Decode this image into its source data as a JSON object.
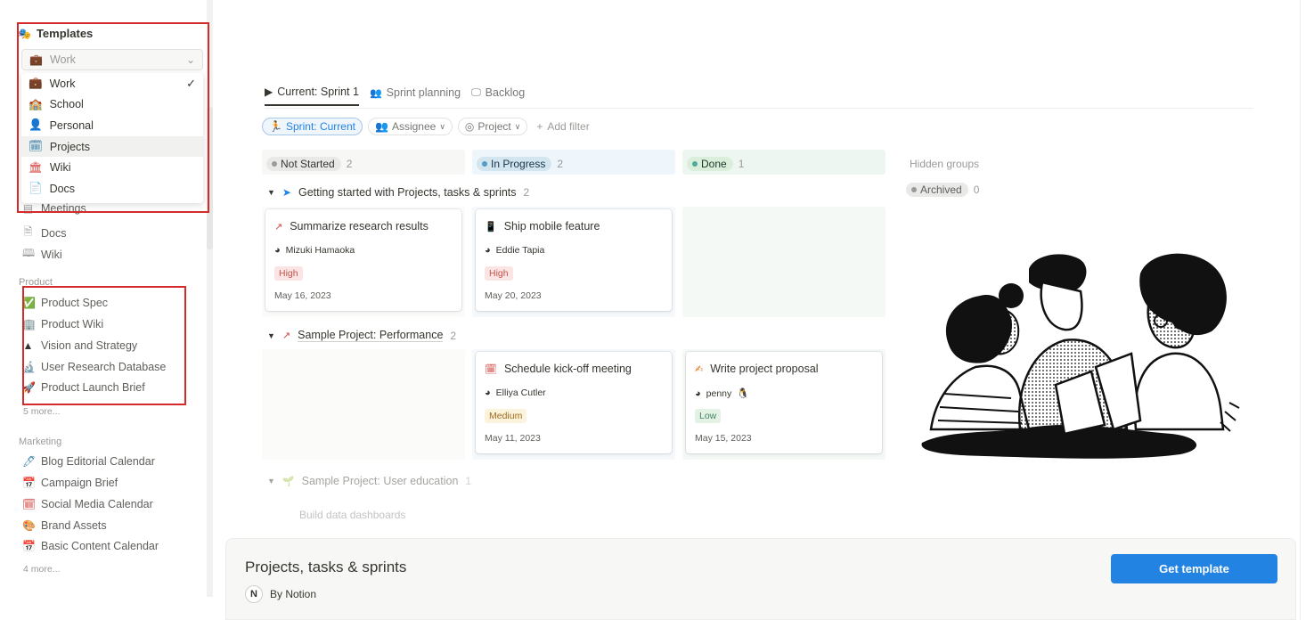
{
  "sidebar": {
    "title": "Templates",
    "select_value": "Work",
    "dropdown": [
      {
        "label": "Work",
        "icon": "briefcase-icon",
        "checked": true
      },
      {
        "label": "School",
        "icon": "school-icon"
      },
      {
        "label": "Personal",
        "icon": "person-icon"
      },
      {
        "label": "Projects",
        "icon": "calendar-icon"
      },
      {
        "label": "Wiki",
        "icon": "library-icon"
      },
      {
        "label": "Docs",
        "icon": "docs-icon"
      }
    ],
    "partial_item": "Meetings",
    "items_top": [
      "Docs",
      "Wiki"
    ],
    "section_product": "Product",
    "product_items": [
      "Product Spec",
      "Product Wiki",
      "Vision and Strategy",
      "User Research Database",
      "Product Launch Brief"
    ],
    "product_more": "5 more...",
    "section_marketing": "Marketing",
    "marketing_items": [
      "Blog Editorial Calendar",
      "Campaign Brief",
      "Social Media Calendar",
      "Brand Assets",
      "Basic Content Calendar"
    ],
    "marketing_more": "4 more..."
  },
  "tabs": [
    "Current: Sprint 1",
    "Sprint planning",
    "Backlog"
  ],
  "filters": {
    "sprint": "Sprint: Current",
    "assignee": "Assignee",
    "project": "Project",
    "add": "Add filter"
  },
  "columns": [
    {
      "label": "Not Started",
      "count": "2",
      "color": "#9b9a97"
    },
    {
      "label": "In Progress",
      "count": "2",
      "color": "#529cca"
    },
    {
      "label": "Done",
      "count": "1",
      "color": "#4dab9a"
    }
  ],
  "hidden_groups": {
    "label": "Hidden groups",
    "archived": "Archived",
    "count": "0"
  },
  "groups": [
    {
      "title": "Getting started with Projects, tasks & sprints",
      "count": "2"
    },
    {
      "title": "Sample Project: Performance",
      "count": "2"
    },
    {
      "title": "Sample Project: User education",
      "count": "1"
    }
  ],
  "faded_card": "Build data dashboards",
  "cards": [
    {
      "title": "Summarize research results",
      "person": "Mizuki Hamaoka",
      "priority": "High",
      "date": "May 16, 2023"
    },
    {
      "title": "Ship mobile feature",
      "person": "Eddie Tapia",
      "priority": "High",
      "date": "May 20, 2023"
    },
    {
      "title": "Schedule kick-off meeting",
      "person": "Elliya Cutler",
      "priority": "Medium",
      "date": "May 11, 2023"
    },
    {
      "title": "Write project proposal",
      "person": "penny",
      "priority": "Low",
      "date": "May 15, 2023"
    }
  ],
  "footer": {
    "title": "Projects, tasks & sprints",
    "by": "By Notion",
    "button": "Get template"
  },
  "colors": {
    "accent": "#2383e2",
    "highlight_box": "#d42a2a"
  }
}
